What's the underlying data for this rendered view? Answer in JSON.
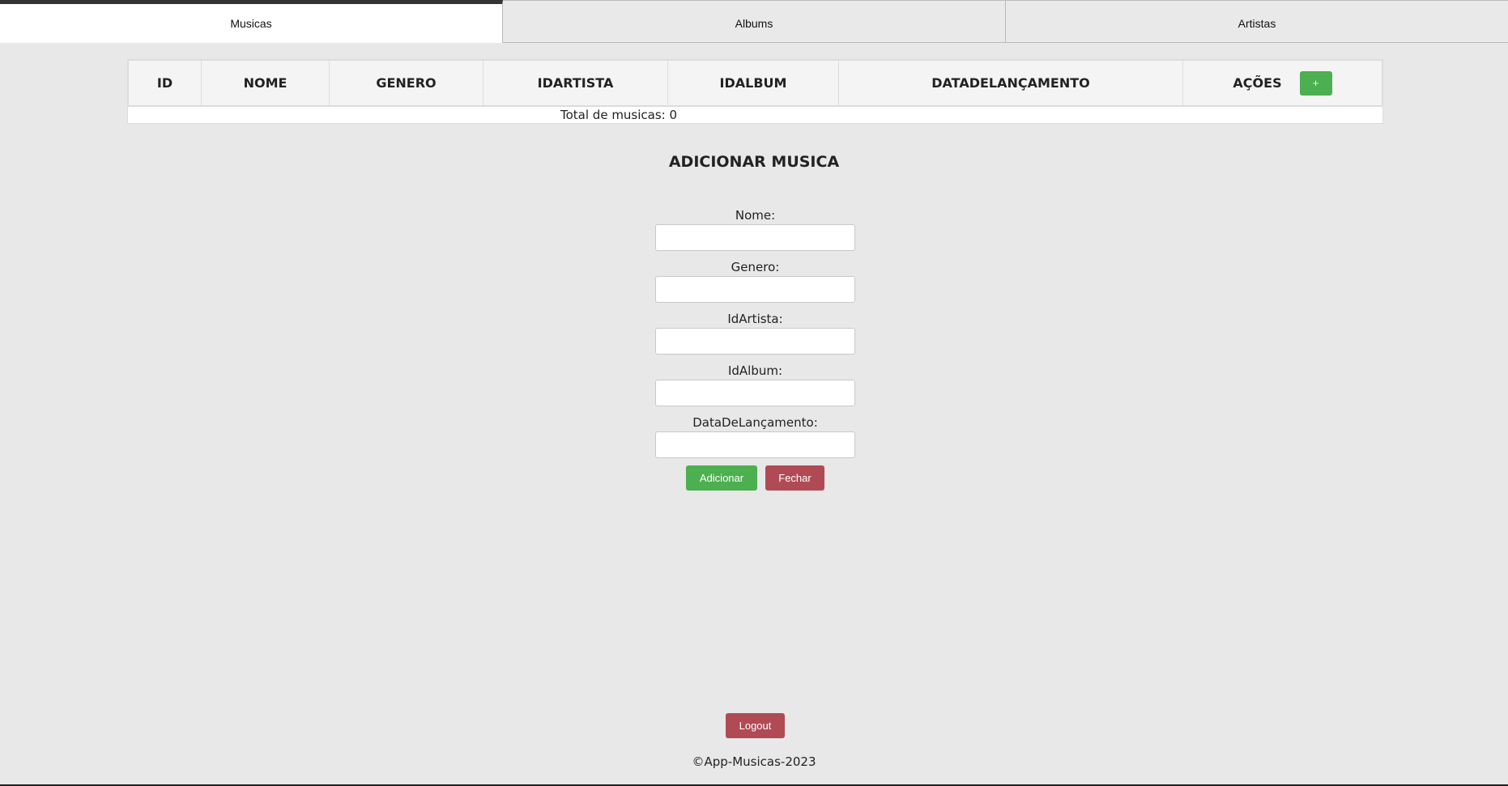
{
  "tabs": [
    {
      "label": "Musicas",
      "active": true
    },
    {
      "label": "Albums",
      "active": false
    },
    {
      "label": "Artistas",
      "active": false
    }
  ],
  "table": {
    "columns": [
      "ID",
      "NOME",
      "GENERO",
      "IDARTISTA",
      "IDALBUM",
      "DATADELANÇAMENTO",
      "AÇÕES"
    ],
    "add_button": "+",
    "total_text": "Total de musicas: 0"
  },
  "form": {
    "title": "ADICIONAR MUSICA",
    "fields": [
      {
        "label": "Nome:",
        "value": ""
      },
      {
        "label": "Genero:",
        "value": ""
      },
      {
        "label": "IdArtista:",
        "value": ""
      },
      {
        "label": "IdAlbum:",
        "value": ""
      },
      {
        "label": "DataDeLançamento:",
        "value": ""
      }
    ],
    "submit_label": "Adicionar",
    "close_label": "Fechar"
  },
  "logout_label": "Logout",
  "footer_text": "©App-Musicas-2023",
  "colors": {
    "green": "#4caf50",
    "red": "#b04a55",
    "background": "#e8e8e8"
  }
}
